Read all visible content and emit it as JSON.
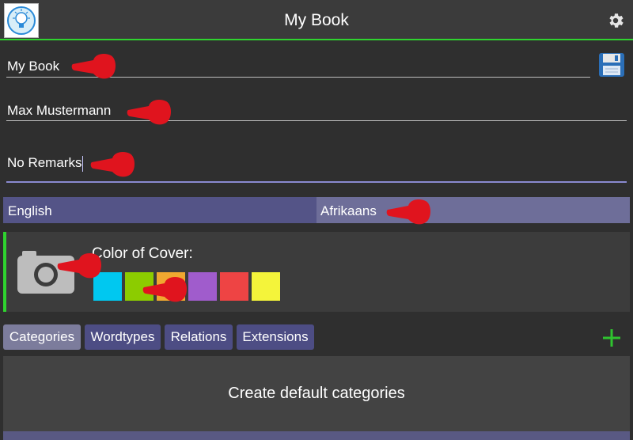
{
  "header": {
    "title": "My Book",
    "logo_icon": "lightbulb-icon",
    "settings_icon": "gear-icon"
  },
  "fields": {
    "title_value": "My Book",
    "author_value": "Max Mustermann",
    "remarks_value": "No Remarks"
  },
  "save_icon": "floppy-disk-icon",
  "languages": {
    "left": "English",
    "right": "Afrikaans"
  },
  "cover": {
    "label": "Color of Cover:",
    "camera_icon": "camera-icon",
    "swatches": [
      "#00c8f0",
      "#8ccc00",
      "#f0a830",
      "#a05ccc",
      "#ee4444",
      "#f4f43a"
    ]
  },
  "tabs": [
    "Categories",
    "Wordtypes",
    "Relations",
    "Extensions"
  ],
  "add_icon": "plus-icon",
  "content": {
    "button_label": "Create default categories"
  },
  "colors": {
    "accent_green": "#2fd42f",
    "tab_active": "#7c7c9c",
    "tab_inactive": "#4d4d84",
    "annotation_red": "#e0141e"
  }
}
